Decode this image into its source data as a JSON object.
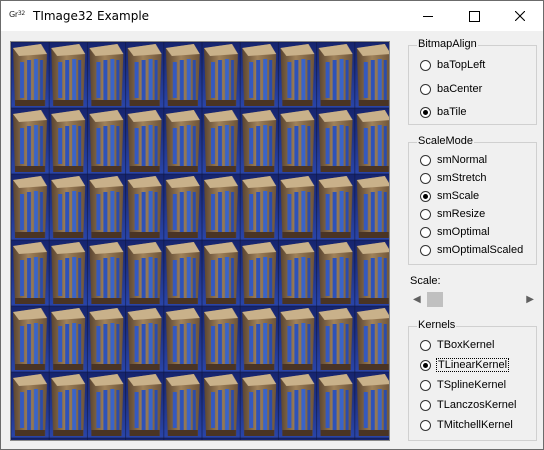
{
  "window": {
    "icon_text": "Gr",
    "icon_sup": "32",
    "title": "TImage32 Example"
  },
  "caption_buttons": [
    "minimize",
    "maximize",
    "close"
  ],
  "image_view": {
    "description_icon": "tiled-building-image"
  },
  "bitmap_align": {
    "legend": "BitmapAlign",
    "options": [
      {
        "label": "baTopLeft",
        "checked": false
      },
      {
        "label": "baCenter",
        "checked": false
      },
      {
        "label": "baTile",
        "checked": true
      }
    ]
  },
  "scale_mode": {
    "legend": "ScaleMode",
    "options": [
      {
        "label": "smNormal",
        "checked": false
      },
      {
        "label": "smStretch",
        "checked": false
      },
      {
        "label": "smScale",
        "checked": true
      },
      {
        "label": "smResize",
        "checked": false
      },
      {
        "label": "smOptimal",
        "checked": false
      },
      {
        "label": "smOptimalScaled",
        "checked": false
      }
    ]
  },
  "scale": {
    "label": "Scale:",
    "left_arrow": "◀",
    "right_arrow": "▶",
    "position": 0.05
  },
  "kernels": {
    "legend": "Kernels",
    "options": [
      {
        "label": "TBoxKernel",
        "checked": false
      },
      {
        "label": "TLinearKernel",
        "checked": true
      },
      {
        "label": "TSplineKernel",
        "checked": false
      },
      {
        "label": "TLanczosKernel",
        "checked": false
      },
      {
        "label": "TMitchellKernel",
        "checked": false
      }
    ]
  },
  "colors": {
    "sky": "#1c2f86",
    "building": "#8a6a44",
    "windows": "#3a64c8"
  }
}
